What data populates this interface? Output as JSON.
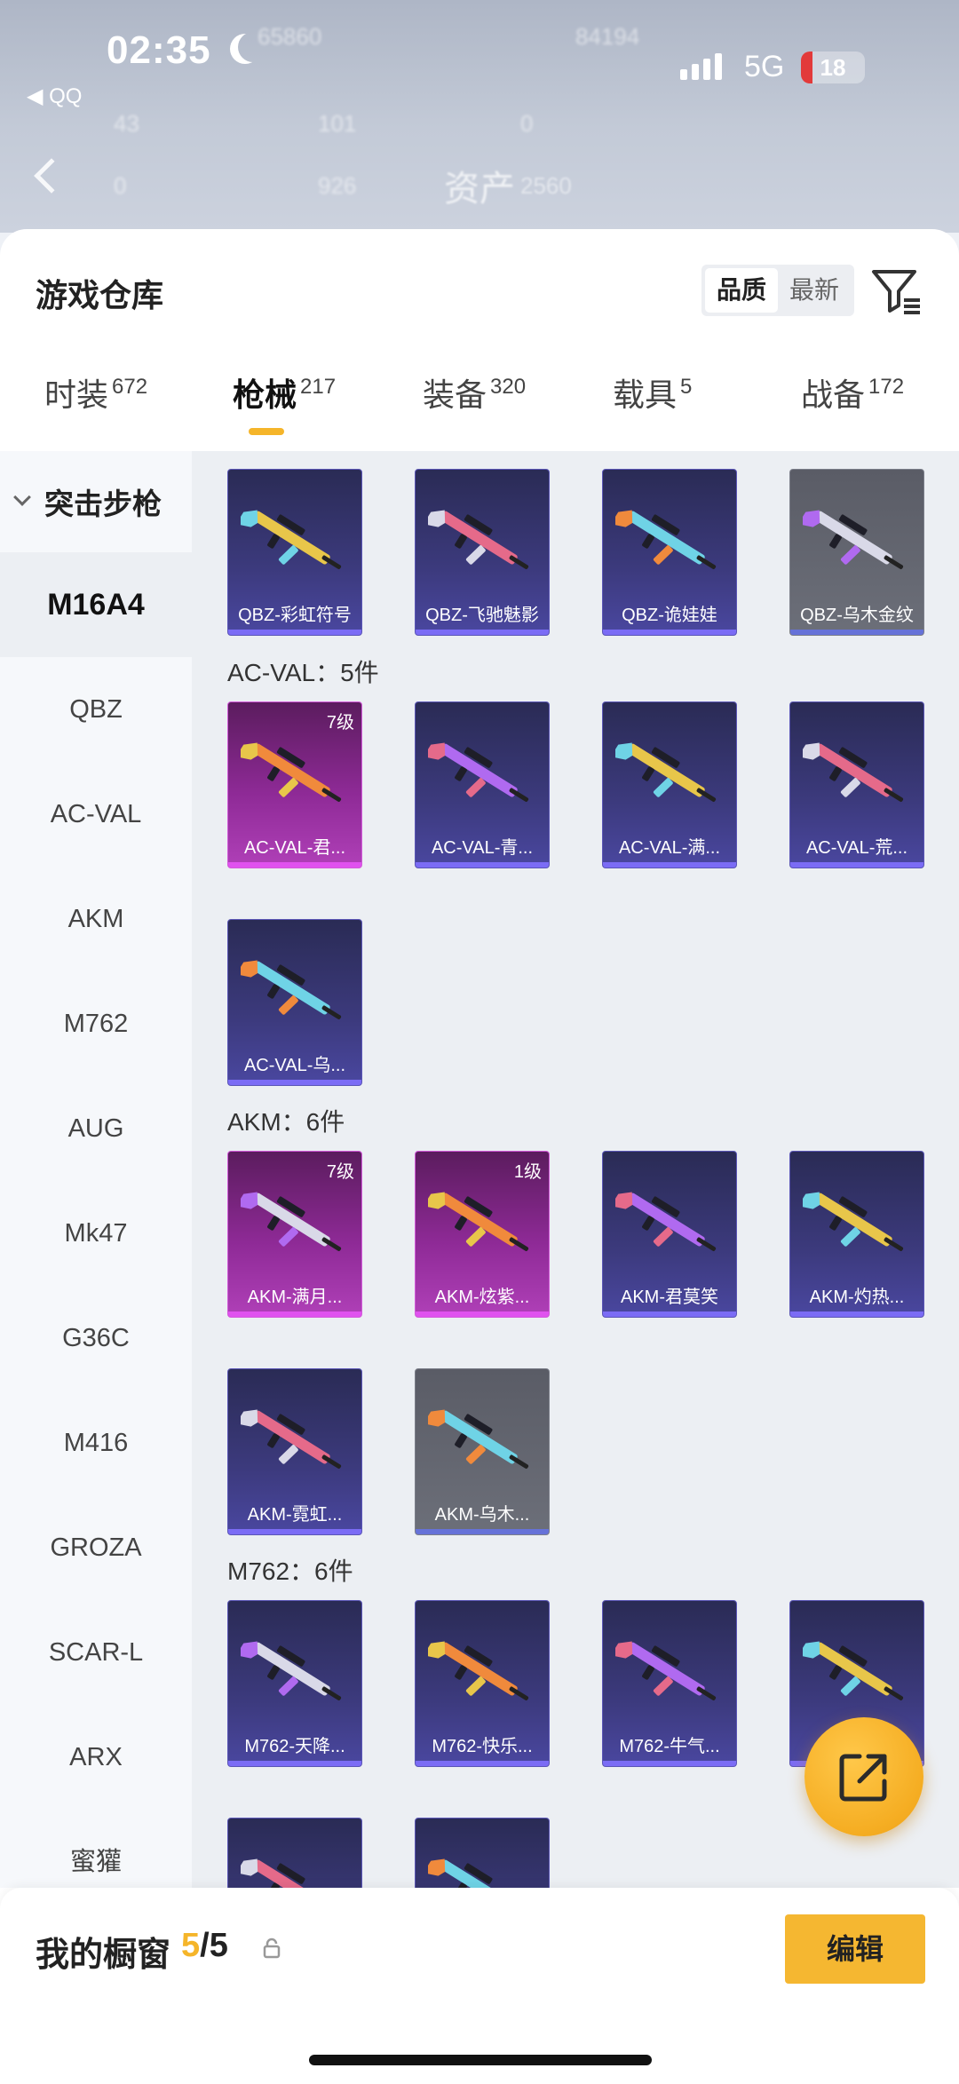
{
  "status_bar": {
    "time": "02:35",
    "back_app": "◀ QQ",
    "network": "5G",
    "battery": "18",
    "battery_level": 0.18,
    "icons": [
      "moon-icon",
      "signal-icon",
      "battery-icon"
    ]
  },
  "header": {
    "asset_label": "资产",
    "asset_value": "2560",
    "blurred_stats": [
      "65860",
      "84194",
      "43",
      "101",
      "0",
      "0",
      "926"
    ]
  },
  "panel": {
    "title": "游戏仓库",
    "sort_options": [
      {
        "label": "品质",
        "active": true
      },
      {
        "label": "最新",
        "active": false
      }
    ],
    "filter_icon": "filter-icon"
  },
  "tabs": [
    {
      "label": "时装",
      "count": "672",
      "active": false
    },
    {
      "label": "枪械",
      "count": "217",
      "active": true
    },
    {
      "label": "装备",
      "count": "320",
      "active": false
    },
    {
      "label": "载具",
      "count": "5",
      "active": false
    },
    {
      "label": "战备",
      "count": "172",
      "active": false
    }
  ],
  "sidebar": {
    "group": "突击步枪",
    "items": [
      "M16A4",
      "QBZ",
      "AC-VAL",
      "AKM",
      "M762",
      "AUG",
      "Mk47",
      "G36C",
      "M416",
      "GROZA",
      "SCAR-L",
      "ARX",
      "蜜獾"
    ],
    "active_index": 0
  },
  "sections": [
    {
      "title": "",
      "cards": [
        {
          "name": "QBZ-彩虹符号",
          "level": "",
          "rarity": "purple"
        },
        {
          "name": "QBZ-飞驰魅影",
          "level": "",
          "rarity": "purple"
        },
        {
          "name": "QBZ-诡娃娃",
          "level": "",
          "rarity": "purple"
        },
        {
          "name": "QBZ-乌木金纹",
          "level": "",
          "rarity": "gray"
        }
      ]
    },
    {
      "title": "AC-VAL：5件",
      "cards": [
        {
          "name": "AC-VAL-君...",
          "level": "7级",
          "rarity": "pink"
        },
        {
          "name": "AC-VAL-青...",
          "level": "",
          "rarity": "purple"
        },
        {
          "name": "AC-VAL-满...",
          "level": "",
          "rarity": "purple"
        },
        {
          "name": "AC-VAL-荒...",
          "level": "",
          "rarity": "purple"
        },
        {
          "name": "AC-VAL-乌...",
          "level": "",
          "rarity": "purple"
        }
      ]
    },
    {
      "title": "AKM：6件",
      "cards": [
        {
          "name": "AKM-满月...",
          "level": "7级",
          "rarity": "pink"
        },
        {
          "name": "AKM-炫紫...",
          "level": "1级",
          "rarity": "pink"
        },
        {
          "name": "AKM-君莫笑",
          "level": "",
          "rarity": "purple"
        },
        {
          "name": "AKM-灼热...",
          "level": "",
          "rarity": "purple"
        },
        {
          "name": "AKM-霓虹...",
          "level": "",
          "rarity": "purple"
        },
        {
          "name": "AKM-乌木...",
          "level": "",
          "rarity": "gray"
        }
      ]
    },
    {
      "title": "M762：6件",
      "cards": [
        {
          "name": "M762-天降...",
          "level": "",
          "rarity": "purple"
        },
        {
          "name": "M762-快乐...",
          "level": "",
          "rarity": "purple"
        },
        {
          "name": "M762-牛气...",
          "level": "",
          "rarity": "purple"
        },
        {
          "name": "M",
          "level": "",
          "rarity": "purple"
        },
        {
          "name": "",
          "level": "",
          "rarity": "purple"
        },
        {
          "name": "",
          "level": "",
          "rarity": "purple"
        }
      ]
    }
  ],
  "bottom_bar": {
    "label": "我的橱窗",
    "count_current": "5",
    "count_sep_total": "/5",
    "edit_label": "编辑"
  },
  "fab_icon": "share-icon",
  "colors": {
    "accent": "#f5b52a",
    "purple_card": "#3c3a7d",
    "pink_card": "#8e2a96",
    "gray_card": "#6c6f79"
  }
}
